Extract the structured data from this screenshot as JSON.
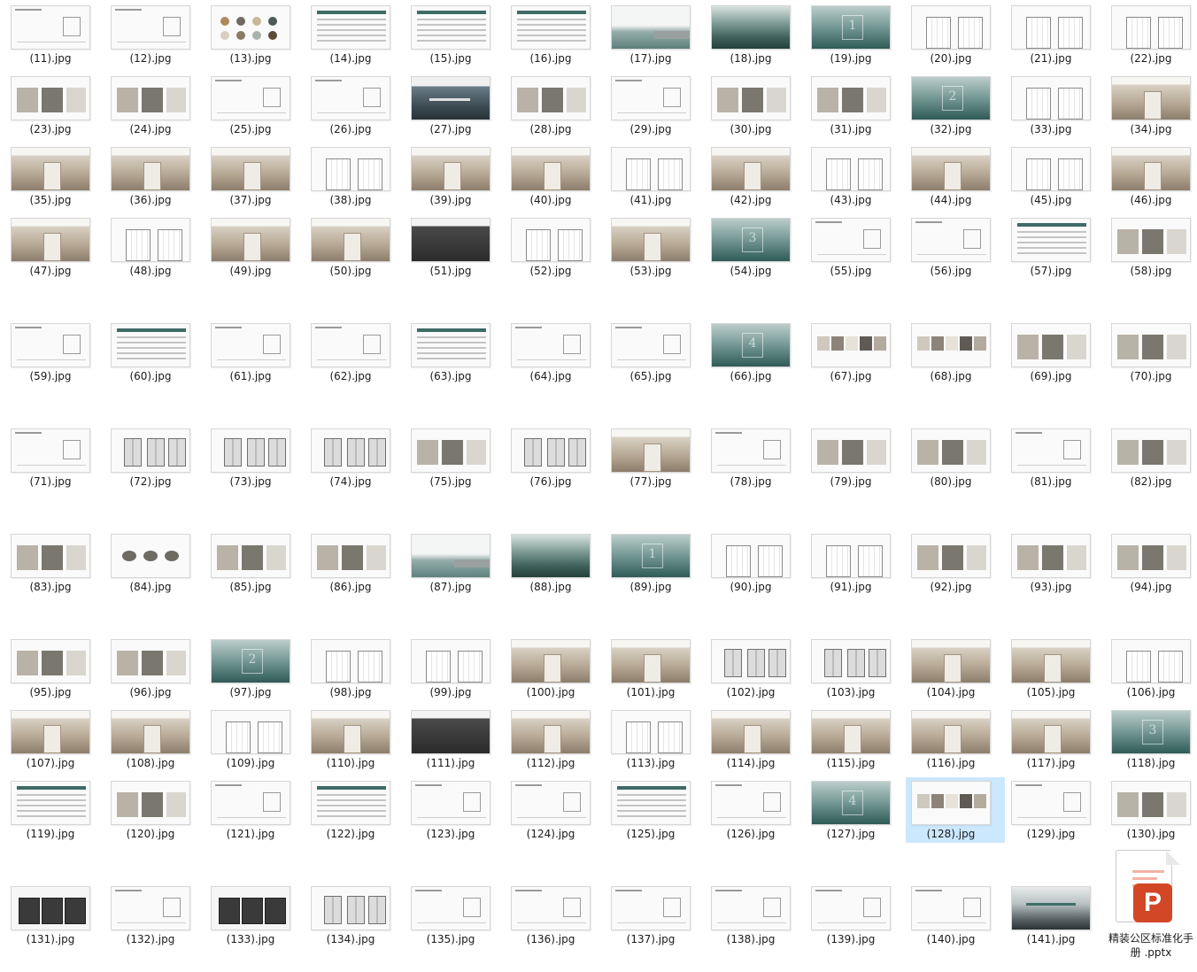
{
  "colors": {
    "selection": "#cce8ff",
    "accent": "#3e6b66",
    "pptx_brand": "#d24726"
  },
  "files": [
    {
      "name": "(11).jpg",
      "kind": "sheet"
    },
    {
      "name": "(12).jpg",
      "kind": "sheet"
    },
    {
      "name": "(13).jpg",
      "kind": "dots"
    },
    {
      "name": "(14).jpg",
      "kind": "text"
    },
    {
      "name": "(15).jpg",
      "kind": "text"
    },
    {
      "name": "(16).jpg",
      "kind": "text"
    },
    {
      "name": "(17).jpg",
      "kind": "banner"
    },
    {
      "name": "(18).jpg",
      "kind": "forest"
    },
    {
      "name": "(19).jpg",
      "kind": "mist",
      "label": "1"
    },
    {
      "name": "(20).jpg",
      "kind": "plan"
    },
    {
      "name": "(21).jpg",
      "kind": "plan"
    },
    {
      "name": "(22).jpg",
      "kind": "plan"
    },
    {
      "name": "(23).jpg",
      "kind": "collage"
    },
    {
      "name": "(24).jpg",
      "kind": "collage"
    },
    {
      "name": "(25).jpg",
      "kind": "sheet"
    },
    {
      "name": "(26).jpg",
      "kind": "sheet"
    },
    {
      "name": "(27).jpg",
      "kind": "landscape"
    },
    {
      "name": "(28).jpg",
      "kind": "collage"
    },
    {
      "name": "(29).jpg",
      "kind": "sheet"
    },
    {
      "name": "(30).jpg",
      "kind": "collage"
    },
    {
      "name": "(31).jpg",
      "kind": "collage"
    },
    {
      "name": "(32).jpg",
      "kind": "mist",
      "label": "2"
    },
    {
      "name": "(33).jpg",
      "kind": "plan"
    },
    {
      "name": "(34).jpg",
      "kind": "photo"
    },
    {
      "name": "(35).jpg",
      "kind": "photo"
    },
    {
      "name": "(36).jpg",
      "kind": "photo"
    },
    {
      "name": "(37).jpg",
      "kind": "photo"
    },
    {
      "name": "(38).jpg",
      "kind": "plan"
    },
    {
      "name": "(39).jpg",
      "kind": "photo"
    },
    {
      "name": "(40).jpg",
      "kind": "photo"
    },
    {
      "name": "(41).jpg",
      "kind": "plan"
    },
    {
      "name": "(42).jpg",
      "kind": "photo"
    },
    {
      "name": "(43).jpg",
      "kind": "plan"
    },
    {
      "name": "(44).jpg",
      "kind": "photo"
    },
    {
      "name": "(45).jpg",
      "kind": "plan"
    },
    {
      "name": "(46).jpg",
      "kind": "photo"
    },
    {
      "name": "(47).jpg",
      "kind": "photo"
    },
    {
      "name": "(48).jpg",
      "kind": "plan"
    },
    {
      "name": "(49).jpg",
      "kind": "photo"
    },
    {
      "name": "(50).jpg",
      "kind": "photo"
    },
    {
      "name": "(51).jpg",
      "kind": "dark"
    },
    {
      "name": "(52).jpg",
      "kind": "plan"
    },
    {
      "name": "(53).jpg",
      "kind": "photo"
    },
    {
      "name": "(54).jpg",
      "kind": "mist",
      "label": "3"
    },
    {
      "name": "(55).jpg",
      "kind": "sheet"
    },
    {
      "name": "(56).jpg",
      "kind": "sheet"
    },
    {
      "name": "(57).jpg",
      "kind": "text"
    },
    {
      "name": "(58).jpg",
      "kind": "collage"
    },
    {
      "name": "(59).jpg",
      "kind": "sheet"
    },
    {
      "name": "(60).jpg",
      "kind": "text"
    },
    {
      "name": "(61).jpg",
      "kind": "sheet"
    },
    {
      "name": "(62).jpg",
      "kind": "sheet"
    },
    {
      "name": "(63).jpg",
      "kind": "text"
    },
    {
      "name": "(64).jpg",
      "kind": "sheet"
    },
    {
      "name": "(65).jpg",
      "kind": "sheet"
    },
    {
      "name": "(66).jpg",
      "kind": "mist",
      "label": "4"
    },
    {
      "name": "(67).jpg",
      "kind": "material"
    },
    {
      "name": "(68).jpg",
      "kind": "material"
    },
    {
      "name": "(69).jpg",
      "kind": "collage"
    },
    {
      "name": "(70).jpg",
      "kind": "collage"
    },
    {
      "name": "(71).jpg",
      "kind": "sheet"
    },
    {
      "name": "(72).jpg",
      "kind": "elev"
    },
    {
      "name": "(73).jpg",
      "kind": "elev"
    },
    {
      "name": "(74).jpg",
      "kind": "elev"
    },
    {
      "name": "(75).jpg",
      "kind": "collage"
    },
    {
      "name": "(76).jpg",
      "kind": "elev"
    },
    {
      "name": "(77).jpg",
      "kind": "photo"
    },
    {
      "name": "(78).jpg",
      "kind": "sheet"
    },
    {
      "name": "(79).jpg",
      "kind": "collage"
    },
    {
      "name": "(80).jpg",
      "kind": "collage"
    },
    {
      "name": "(81).jpg",
      "kind": "sheet"
    },
    {
      "name": "(82).jpg",
      "kind": "collage"
    },
    {
      "name": "(83).jpg",
      "kind": "collage"
    },
    {
      "name": "(84).jpg",
      "kind": "stone"
    },
    {
      "name": "(85).jpg",
      "kind": "collage"
    },
    {
      "name": "(86).jpg",
      "kind": "collage"
    },
    {
      "name": "(87).jpg",
      "kind": "banner"
    },
    {
      "name": "(88).jpg",
      "kind": "forest"
    },
    {
      "name": "(89).jpg",
      "kind": "mist",
      "label": "1"
    },
    {
      "name": "(90).jpg",
      "kind": "plan"
    },
    {
      "name": "(91).jpg",
      "kind": "plan"
    },
    {
      "name": "(92).jpg",
      "kind": "collage"
    },
    {
      "name": "(93).jpg",
      "kind": "collage"
    },
    {
      "name": "(94).jpg",
      "kind": "collage"
    },
    {
      "name": "(95).jpg",
      "kind": "collage"
    },
    {
      "name": "(96).jpg",
      "kind": "collage"
    },
    {
      "name": "(97).jpg",
      "kind": "mist",
      "label": "2"
    },
    {
      "name": "(98).jpg",
      "kind": "plan"
    },
    {
      "name": "(99).jpg",
      "kind": "plan"
    },
    {
      "name": "(100).jpg",
      "kind": "photo"
    },
    {
      "name": "(101).jpg",
      "kind": "photo"
    },
    {
      "name": "(102).jpg",
      "kind": "elev"
    },
    {
      "name": "(103).jpg",
      "kind": "elev"
    },
    {
      "name": "(104).jpg",
      "kind": "photo"
    },
    {
      "name": "(105).jpg",
      "kind": "photo"
    },
    {
      "name": "(106).jpg",
      "kind": "plan"
    },
    {
      "name": "(107).jpg",
      "kind": "photo"
    },
    {
      "name": "(108).jpg",
      "kind": "photo"
    },
    {
      "name": "(109).jpg",
      "kind": "plan"
    },
    {
      "name": "(110).jpg",
      "kind": "photo"
    },
    {
      "name": "(111).jpg",
      "kind": "dark"
    },
    {
      "name": "(112).jpg",
      "kind": "photo"
    },
    {
      "name": "(113).jpg",
      "kind": "plan"
    },
    {
      "name": "(114).jpg",
      "kind": "photo"
    },
    {
      "name": "(115).jpg",
      "kind": "photo"
    },
    {
      "name": "(116).jpg",
      "kind": "photo"
    },
    {
      "name": "(117).jpg",
      "kind": "photo"
    },
    {
      "name": "(118).jpg",
      "kind": "mist",
      "label": "3"
    },
    {
      "name": "(119).jpg",
      "kind": "text"
    },
    {
      "name": "(120).jpg",
      "kind": "collage"
    },
    {
      "name": "(121).jpg",
      "kind": "sheet"
    },
    {
      "name": "(122).jpg",
      "kind": "text"
    },
    {
      "name": "(123).jpg",
      "kind": "sheet"
    },
    {
      "name": "(124).jpg",
      "kind": "sheet"
    },
    {
      "name": "(125).jpg",
      "kind": "text"
    },
    {
      "name": "(126).jpg",
      "kind": "sheet"
    },
    {
      "name": "(127).jpg",
      "kind": "mist",
      "label": "4"
    },
    {
      "name": "(128).jpg",
      "kind": "material",
      "selected": true
    },
    {
      "name": "(129).jpg",
      "kind": "sheet"
    },
    {
      "name": "(130).jpg",
      "kind": "collage"
    },
    {
      "name": "(131).jpg",
      "kind": "cab"
    },
    {
      "name": "(132).jpg",
      "kind": "sheet"
    },
    {
      "name": "(133).jpg",
      "kind": "cab"
    },
    {
      "name": "(134).jpg",
      "kind": "elev"
    },
    {
      "name": "(135).jpg",
      "kind": "sheet"
    },
    {
      "name": "(136).jpg",
      "kind": "sheet"
    },
    {
      "name": "(137).jpg",
      "kind": "sheet"
    },
    {
      "name": "(138).jpg",
      "kind": "sheet"
    },
    {
      "name": "(139).jpg",
      "kind": "sheet"
    },
    {
      "name": "(140).jpg",
      "kind": "sheet"
    },
    {
      "name": "(141).jpg",
      "kind": "mountain"
    }
  ],
  "pptx": {
    "name": "精装公区标准化手册 .pptx",
    "badge": "P",
    "icon": "powerpoint-icon"
  }
}
